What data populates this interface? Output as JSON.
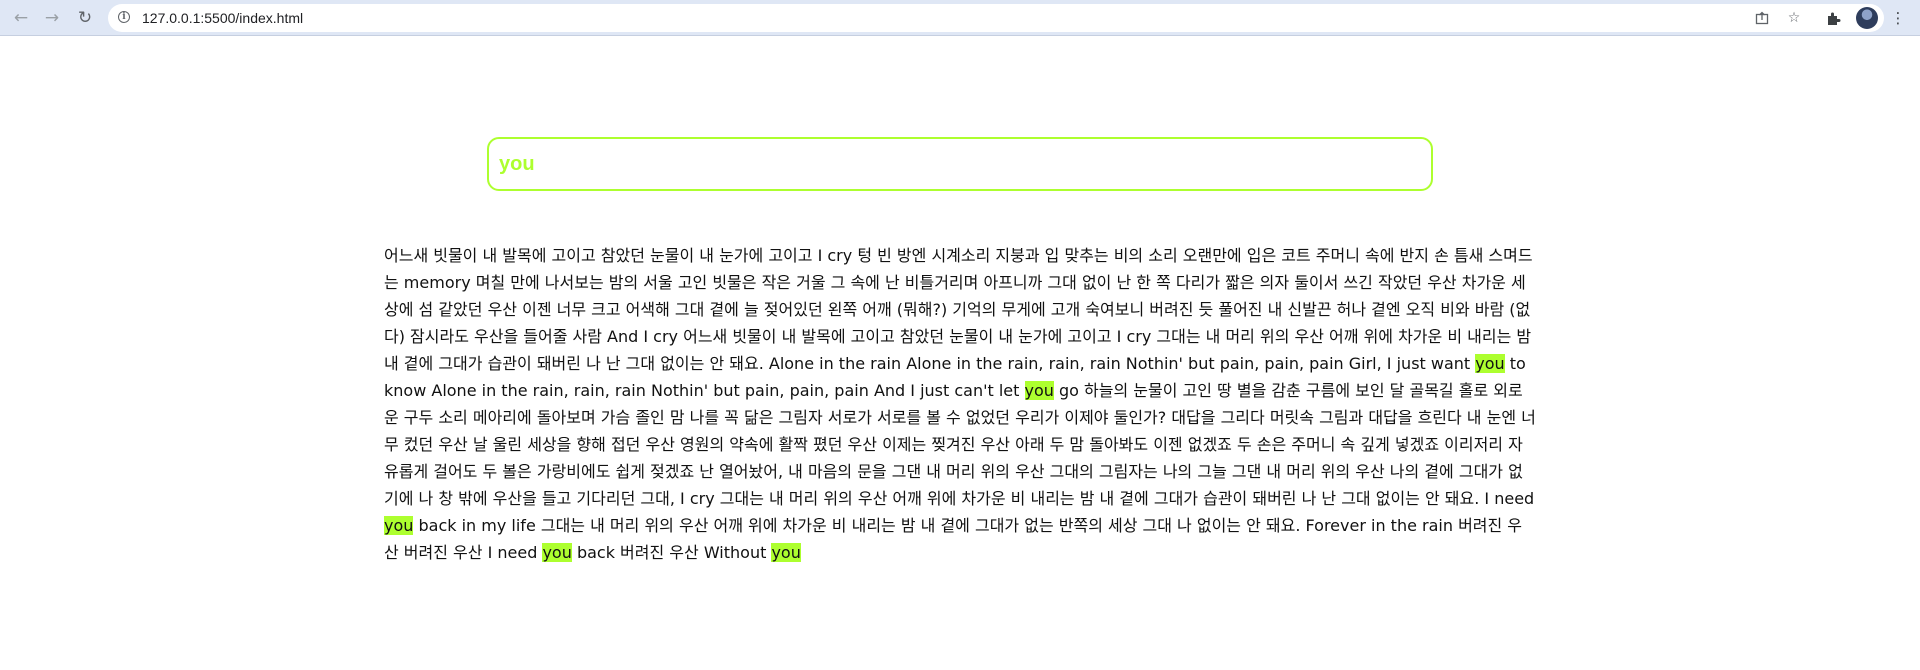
{
  "browser": {
    "url": "127.0.0.1:5500/index.html",
    "icons": {
      "back": "arrow-left-icon",
      "forward": "arrow-right-icon",
      "reload": "reload-icon",
      "site_info": "info-icon",
      "share": "share-icon",
      "bookmark": "star-icon",
      "extensions": "puzzle-icon",
      "profile": "avatar",
      "menu": "kebab-menu-icon"
    }
  },
  "search": {
    "value": "you",
    "accent_color": "#adff2f"
  },
  "lyrics": {
    "highlight_color": "#adff2f",
    "segments": [
      {
        "text": "어느새 빗물이 내 발목에 고이고 참았던 눈물이 내 눈가에 고이고 I cry 텅 빈 방엔 시계소리 지붕과 입 맞추는 비의 소리 오랜만에 입은 코트 주머니 속에 반지 손 틈새 스며드는 memory 며칠 만에 나서보는 밤의 서울 고인 빗물은 작은 거울 그 속에 난 비틀거리며 아프니까 그대 없이 난 한 쪽 다리가 짧은 의자 둘이서 쓰긴 작았던 우산 차가운 세상에 섬 같았던 우산 이젠 너무 크고 어색해 그대 곁에 늘 젖어있던 왼쪽 어깨 (뭐해?) 기억의 무게에 고개 숙여보니 버려진 듯 풀어진 내 신발끈 허나 곁엔 오직 비와 바람 (없다) 잠시라도 우산을 들어줄 사람 And I cry 어느새 빗물이 내 발목에 고이고 참았던 눈물이 내 눈가에 고이고 I cry 그대는 내 머리 위의 우산 어깨 위에 차가운 비 내리는 밤 내 곁에 그대가 습관이 돼버린 나 난 그대 없이는 안 돼요. Alone in the rain Alone in the rain, rain, rain Nothin' but pain, pain, pain Girl, I just want ",
        "hl": false
      },
      {
        "text": "you",
        "hl": true
      },
      {
        "text": " to know Alone in the rain, rain, rain Nothin' but pain, pain, pain And I just can't let ",
        "hl": false
      },
      {
        "text": "you",
        "hl": true
      },
      {
        "text": " go 하늘의 눈물이 고인 땅 별을 감춘 구름에 보인 달 골목길 홀로 외로운 구두 소리 메아리에 돌아보며 가슴 졸인 맘 나를 꼭 닮은 그림자 서로가 서로를 볼 수 없었던 우리가 이제야 둘인가? 대답을 그리다 머릿속 그림과 대답을 흐린다 내 눈엔 너무 컸던 우산 날 울린 세상을 향해 접던 우산 영원의 약속에 활짝 폈던 우산 이제는 찢겨진 우산 아래 두 맘 돌아봐도 이젠 없겠죠 두 손은 주머니 속 깊게 넣겠죠 이리저리 자유롭게 걸어도 두 볼은 가랑비에도 쉽게 젖겠죠 난 열어놨어, 내 마음의 문을 그댄 내 머리 위의 우산 그대의 그림자는 나의 그늘 그댄 내 머리 위의 우산 나의 곁에 그대가 없기에 나 창 밖에 우산을 들고 기다리던 그대, I cry 그대는 내 머리 위의 우산 어깨 위에 차가운 비 내리는 밤 내 곁에 그대가 습관이 돼버린 나 난 그대 없이는 안 돼요. I need ",
        "hl": false
      },
      {
        "text": "you",
        "hl": true
      },
      {
        "text": " back in my life 그대는 내 머리 위의 우산 어깨 위에 차가운 비 내리는 밤 내 곁에 그대가 없는 반쪽의 세상 그대 나 없이는 안 돼요. Forever in the rain 버려진 우산 버려진 우산 I need ",
        "hl": false
      },
      {
        "text": "you",
        "hl": true
      },
      {
        "text": " back 버려진 우산 Without ",
        "hl": false
      },
      {
        "text": "you",
        "hl": true
      }
    ]
  }
}
